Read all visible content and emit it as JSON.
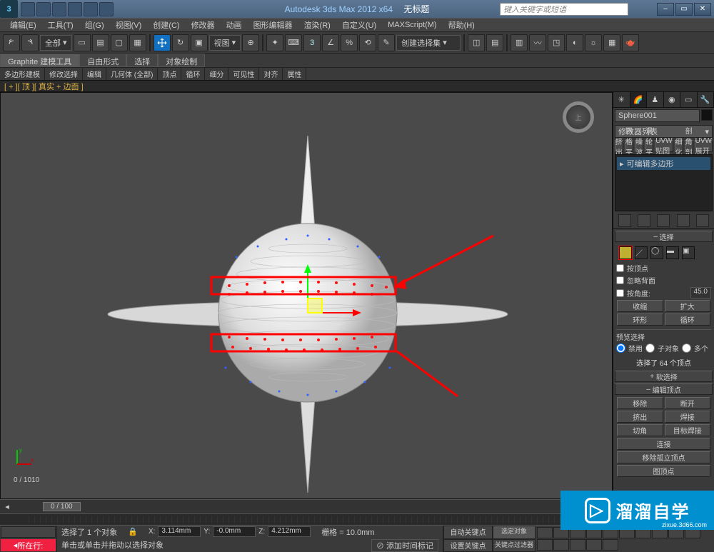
{
  "title": {
    "app": "Autodesk 3ds Max",
    "version": "2012 x64",
    "doc": "无标题"
  },
  "search_placeholder": "键入关键字或短语",
  "menus": [
    "编辑(E)",
    "工具(T)",
    "组(G)",
    "视图(V)",
    "创建(C)",
    "修改器",
    "动画",
    "图形编辑器",
    "渲染(R)",
    "自定义(U)",
    "MAXScript(M)",
    "帮助(H)"
  ],
  "toolbar_all": "全部",
  "toolbar_view": "视图",
  "toolbar_selset": "创建选择集",
  "ribbon": {
    "tab1": "Graphite 建模工具",
    "tab2": "自由形式",
    "tab3": "选择",
    "tab4": "对象绘制"
  },
  "ribbon2": [
    "多边形建模",
    "修改选择",
    "编辑",
    "几何体 (全部)",
    "顶点",
    "循环",
    "细分",
    "可见性",
    "对齐",
    "属性"
  ],
  "bracket": "[ + ][ 顶 ][ 真实 + 边面 ]",
  "viewcube": "上",
  "vp_count": "0 / 1010",
  "axis": {
    "x": "x",
    "y": "y"
  },
  "cp": {
    "obj_name": "Sphere001",
    "mod_dropdown": "修改器列表",
    "mod_buttons": [
      "挤出",
      "网格平滑",
      "噪波",
      "涡轮平滑",
      "UVW 贴图",
      "细化",
      "剖角剖面",
      "UVW 展开"
    ],
    "stack_item": "可编辑多边形",
    "rollout_sel": "选择",
    "by_vertex": "按顶点",
    "ignore_backface": "忽略背面",
    "by_angle": "按角度:",
    "angle_val": "45.0",
    "shrink": "收缩",
    "grow": "扩大",
    "ring": "环形",
    "loop": "循环",
    "preview_sel": "预览选择",
    "disable": "禁用",
    "subobj": "子对象",
    "multi": "多个",
    "sel_count": "选择了 64 个顶点",
    "rollout_soft": "软选择",
    "rollout_editvert": "编辑顶点",
    "remove": "移除",
    "break": "断开",
    "extrude": "挤出",
    "weld": "焊接",
    "chamfer": "切角",
    "target_weld": "目标焊接",
    "connect": "连接",
    "remove_iso": "移除孤立顶点",
    "collapse": "图顶点"
  },
  "time": {
    "slider": "0 / 100"
  },
  "status": {
    "now": "所在行:",
    "prompt_top": "选择了 1 个对象",
    "prompt_bottom": "单击或单击并拖动以选择对象",
    "add_tag": "添加时间标记",
    "x": "3.114mm",
    "y": "-0.0mm",
    "z": "4.212mm",
    "grid": "栅格 = 10.0mm",
    "autokey": "自动关键点",
    "selset": "选定对象",
    "setkey": "设置关键点",
    "keyfilter": "关键点过滤器"
  },
  "watermark": {
    "text": "溜溜自学",
    "url": "zixue.3d66.com"
  }
}
